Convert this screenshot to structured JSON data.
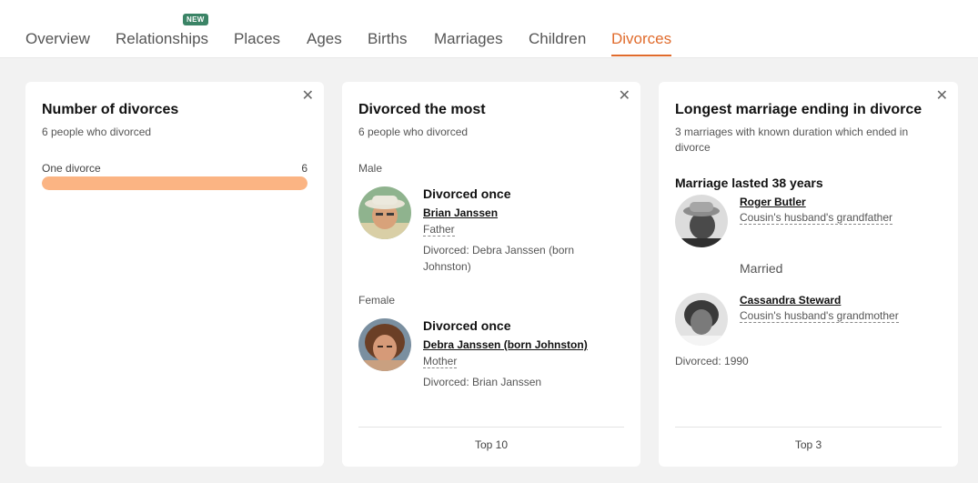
{
  "tabs": [
    {
      "label": "Overview"
    },
    {
      "label": "Relationships",
      "badge": "NEW"
    },
    {
      "label": "Places"
    },
    {
      "label": "Ages"
    },
    {
      "label": "Births"
    },
    {
      "label": "Marriages"
    },
    {
      "label": "Children"
    },
    {
      "label": "Divorces",
      "active": true
    }
  ],
  "accent_color": "#e06b2c",
  "badge_color": "#3b8466",
  "bar_color": "#fbb483",
  "cards": {
    "number": {
      "title": "Number of divorces",
      "subtitle": "6 people who divorced",
      "bar": {
        "label": "One divorce",
        "count": "6",
        "fraction": 1.0
      }
    },
    "most": {
      "title": "Divorced the most",
      "subtitle": "6 people who divorced",
      "male_label": "Male",
      "female_label": "Female",
      "male": {
        "title": "Divorced once",
        "name": "Brian Janssen",
        "relation": "Father",
        "divorced": "Divorced:  Debra Janssen (born Johnston)"
      },
      "female": {
        "title": "Divorced once",
        "name": "Debra Janssen (born Johnston)",
        "relation": "Mother",
        "divorced": "Divorced:  Brian Janssen"
      },
      "footer": "Top 10"
    },
    "longest": {
      "title": "Longest marriage ending in divorce",
      "subtitle": "3 marriages with known duration which ended in divorce",
      "heading": "Marriage lasted 38 years",
      "person1": {
        "name": "Roger Butler",
        "relation": "Cousin's husband's grandfather"
      },
      "married_label": "Married",
      "person2": {
        "name": "Cassandra Steward",
        "relation": "Cousin's husband's grandmother"
      },
      "divorced": "Divorced: 1990",
      "footer": "Top 3"
    }
  }
}
